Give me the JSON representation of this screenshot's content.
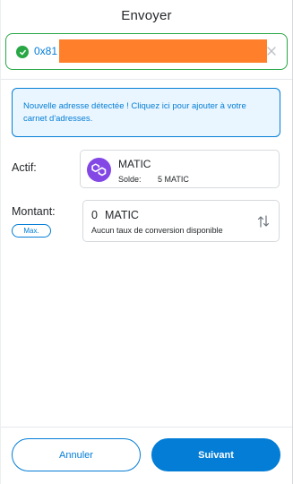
{
  "header": {
    "title": "Envoyer"
  },
  "recipient": {
    "address_prefix": "0x81",
    "status": "valid"
  },
  "notice": {
    "text": "Nouvelle adresse détectée ! Cliquez ici pour ajouter à votre carnet d'adresses."
  },
  "asset": {
    "label": "Actif:",
    "name": "MATIC",
    "balance_label": "Solde:",
    "balance_value": "5 MATIC",
    "icon": "matic-logo"
  },
  "amount": {
    "label": "Montant:",
    "max_label": "Max.",
    "value": "0",
    "unit": "MATIC",
    "conversion_note": "Aucun taux de conversion disponible"
  },
  "footer": {
    "cancel_label": "Annuler",
    "next_label": "Suivant"
  },
  "colors": {
    "accent": "#037dd6",
    "success": "#28a745",
    "redaction": "#ff7f2a",
    "matic": "#8247e5"
  }
}
